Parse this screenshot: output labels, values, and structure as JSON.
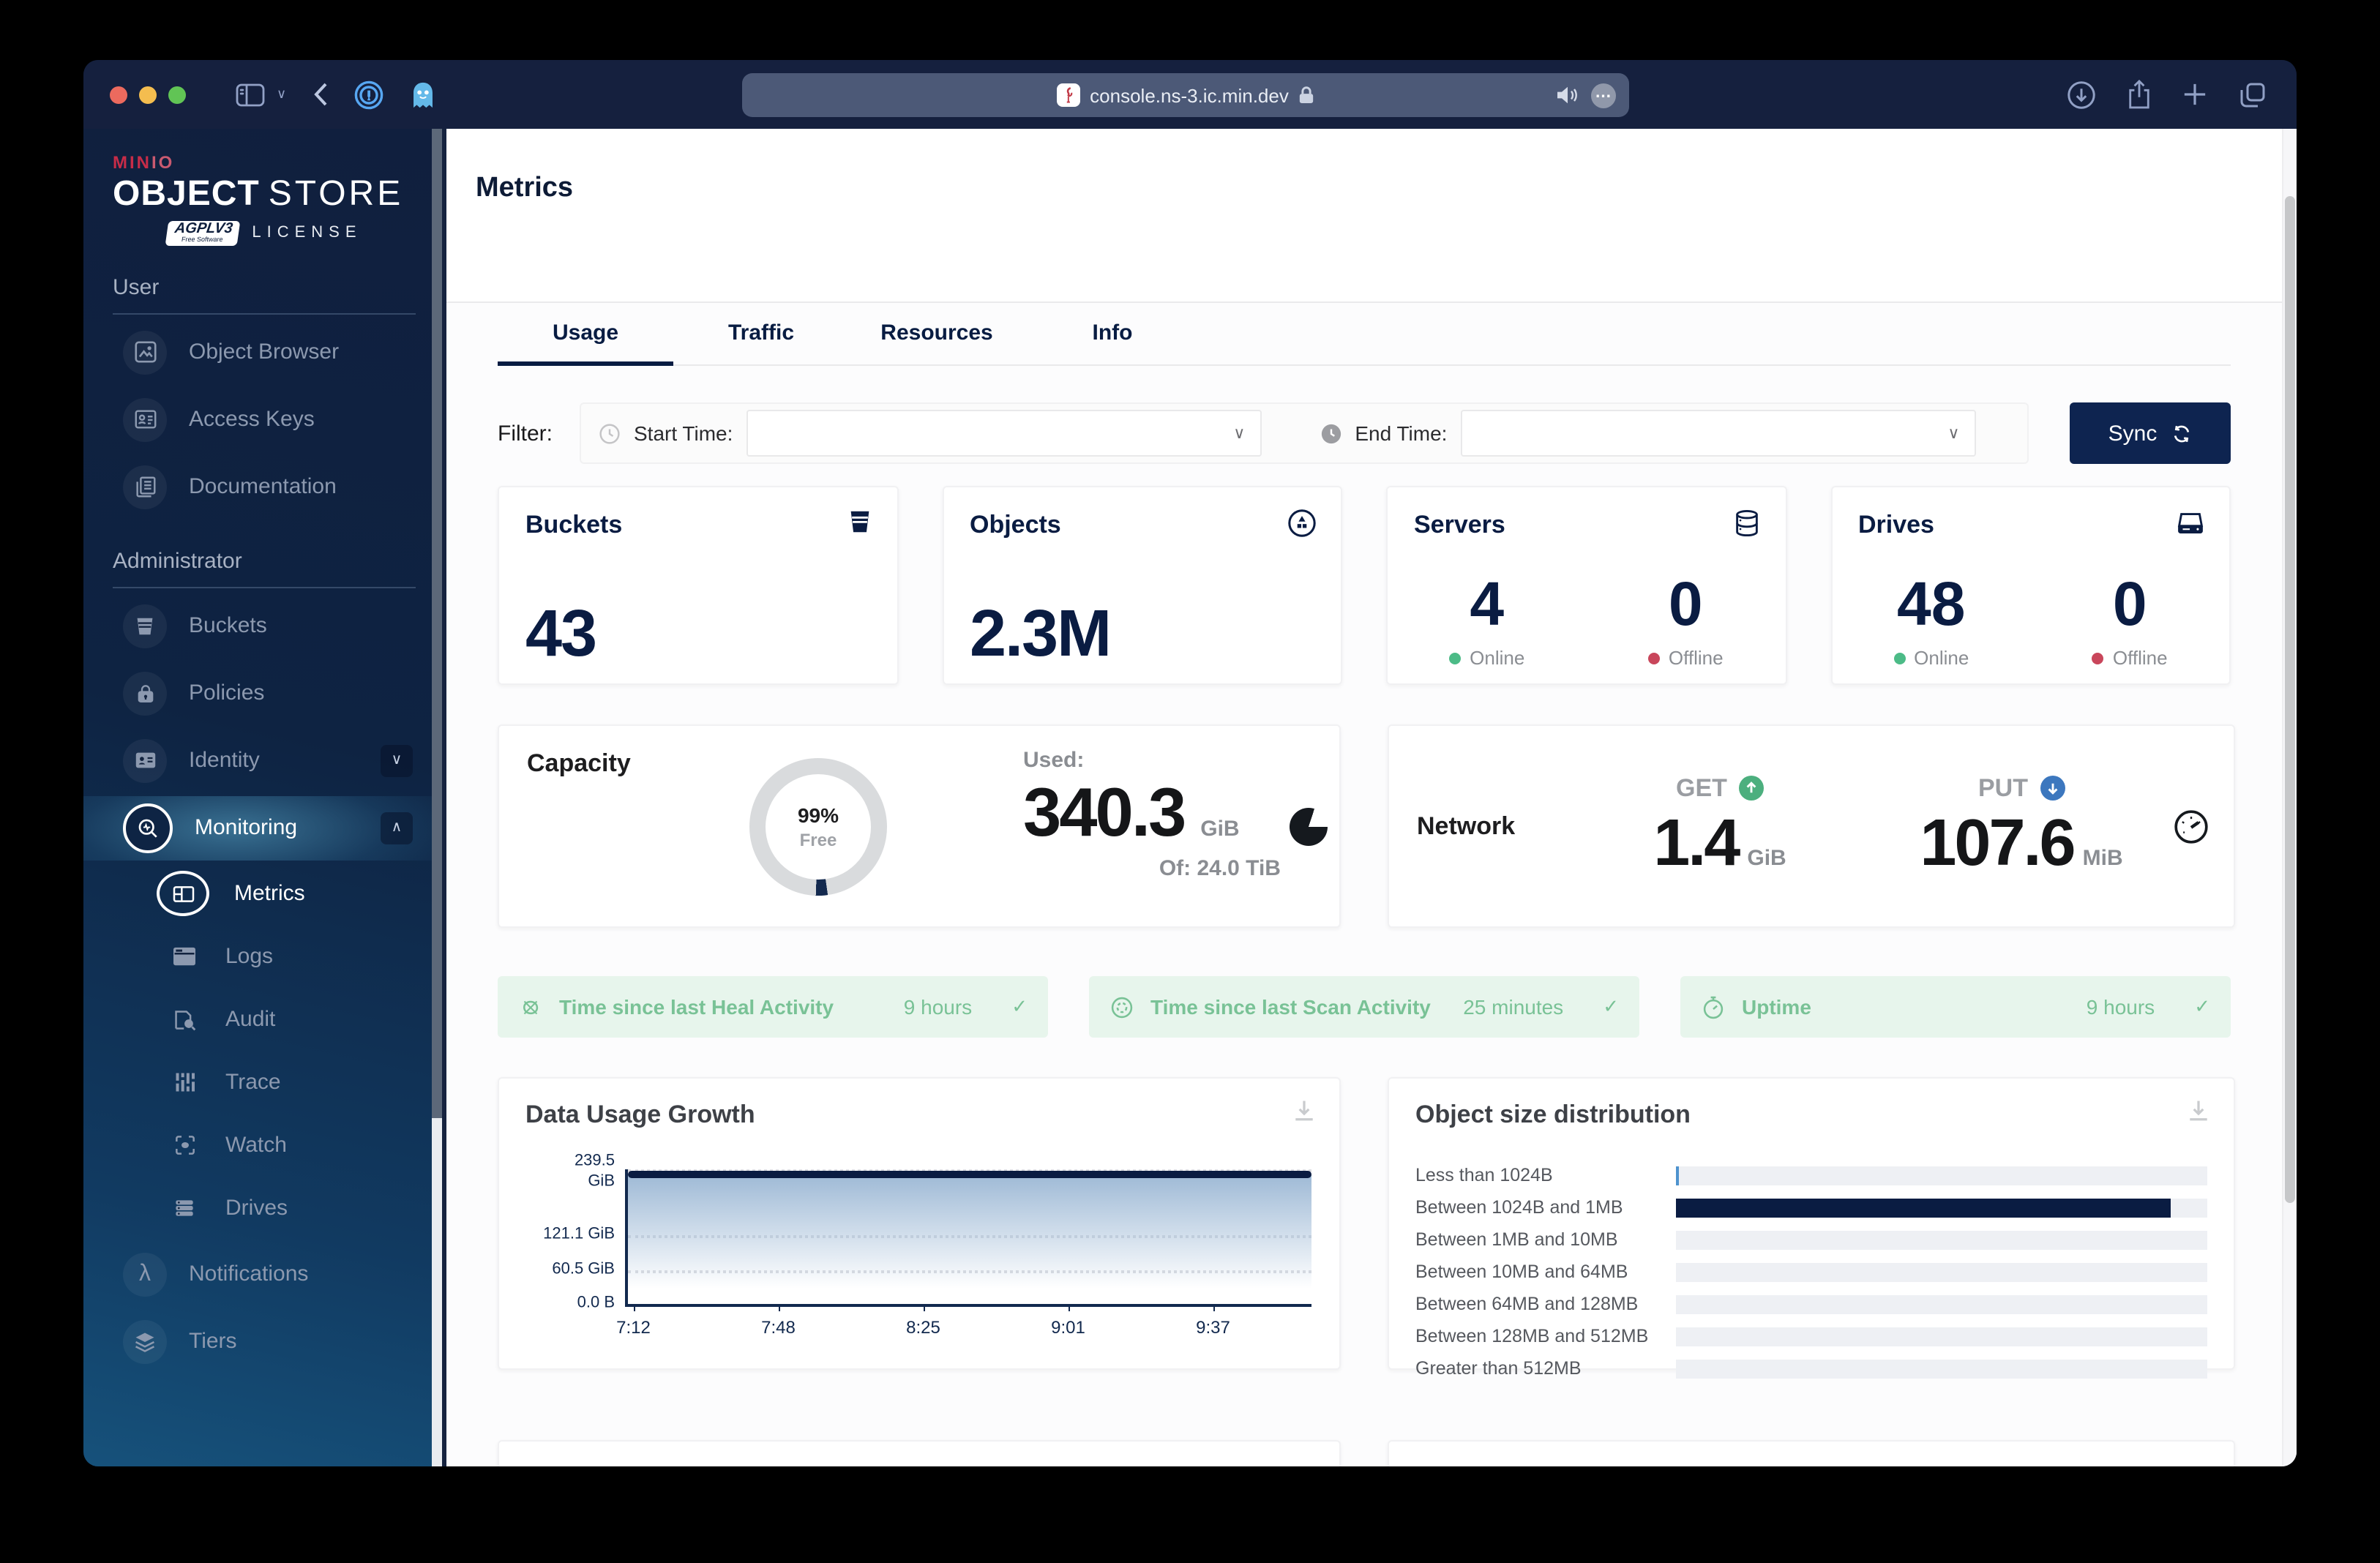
{
  "colors": {
    "brand_navy": "#081C42",
    "brand_red": "#C72C48",
    "online_green": "#4CBB87",
    "offline_red": "#C9465B",
    "get_green": "#4CAF7E",
    "put_blue": "#3C77BE",
    "status_green_text": "#79C296",
    "status_green_bg": "#E7F5EC",
    "bar_light_blue": "#4E93CE"
  },
  "browser": {
    "url": "console.ns-3.ic.min.dev"
  },
  "sidebar": {
    "logo": {
      "brand_bold": "MIN",
      "brand_light": "IO",
      "product_bold": "OBJECT",
      "product_light": "STORE",
      "license_badge": "AGPLV3",
      "license_badge_sub": "Free Software",
      "license_label": "LICENSE"
    },
    "user_section": {
      "label": "User",
      "items": [
        {
          "label": "Object Browser"
        },
        {
          "label": "Access Keys"
        },
        {
          "label": "Documentation"
        }
      ]
    },
    "admin_section": {
      "label": "Administrator",
      "items": [
        {
          "label": "Buckets"
        },
        {
          "label": "Policies"
        },
        {
          "label": "Identity"
        },
        {
          "label": "Monitoring"
        }
      ]
    },
    "monitoring_submenu": [
      {
        "label": "Metrics"
      },
      {
        "label": "Logs"
      },
      {
        "label": "Audit"
      },
      {
        "label": "Trace"
      },
      {
        "label": "Watch"
      },
      {
        "label": "Drives"
      }
    ],
    "more_items": [
      {
        "label": "Notifications"
      },
      {
        "label": "Tiers"
      }
    ]
  },
  "page": {
    "title": "Metrics",
    "tabs": [
      {
        "label": "Usage"
      },
      {
        "label": "Traffic"
      },
      {
        "label": "Resources"
      },
      {
        "label": "Info"
      }
    ],
    "filter": {
      "label": "Filter:",
      "start_time_label": "Start Time:",
      "start_time_value": "",
      "end_time_label": "End Time:",
      "end_time_value": "",
      "sync_button": "Sync"
    }
  },
  "summary_cards": {
    "buckets": {
      "title": "Buckets",
      "value": "43"
    },
    "objects": {
      "title": "Objects",
      "value": "2.3M"
    },
    "servers": {
      "title": "Servers",
      "online": "4",
      "online_label": "Online",
      "offline": "0",
      "offline_label": "Offline"
    },
    "drives": {
      "title": "Drives",
      "online": "48",
      "online_label": "Online",
      "offline": "0",
      "offline_label": "Offline"
    }
  },
  "capacity_card": {
    "title": "Capacity",
    "gauge_pct": "99%",
    "gauge_label": "Free",
    "used_label": "Used:",
    "used_value": "340.3",
    "used_unit": "GiB",
    "total_label": "Of: 24.0 TiB"
  },
  "network_card": {
    "title": "Network",
    "get_label": "GET",
    "get_value": "1.4",
    "get_unit": "GiB",
    "put_label": "PUT",
    "put_value": "107.6",
    "put_unit": "MiB"
  },
  "status_bars": [
    {
      "label": "Time since last Heal Activity",
      "value": "9 hours"
    },
    {
      "label": "Time since last Scan Activity",
      "value": "25 minutes"
    },
    {
      "label": "Uptime",
      "value": "9 hours"
    }
  ],
  "chart_data": [
    {
      "type": "area",
      "title": "Data Usage Growth",
      "x": [
        "7:12",
        "7:48",
        "8:25",
        "9:01",
        "9:37"
      ],
      "series": [
        {
          "name": "Data Usage",
          "values": [
            232,
            232,
            232,
            232,
            232,
            232
          ]
        }
      ],
      "y_ticks": [
        {
          "line1": "239.5",
          "line2": "GiB"
        },
        {
          "line1": "121.1 GiB",
          "line2": ""
        },
        {
          "line1": "60.5 GiB",
          "line2": ""
        },
        {
          "line1": "0.0 B",
          "line2": ""
        }
      ],
      "ylim": [
        0,
        239.5
      ],
      "grid": "dotted horizontal",
      "legend": "none",
      "line_color": "#081C42"
    },
    {
      "type": "bar",
      "title": "Object size distribution",
      "orientation": "horizontal",
      "categories": [
        "Less than 1024B",
        "Between 1024B and 1MB",
        "Between 1MB and 10MB",
        "Between 10MB and 64MB",
        "Between 64MB and 128MB",
        "Between 128MB and 512MB",
        "Greater than 512MB"
      ],
      "values_pct": [
        0.6,
        93,
        0,
        0,
        0,
        0,
        0
      ],
      "bar_colors": [
        "#4E93CE",
        "#081C42",
        "#081C42",
        "#081C42",
        "#081C42",
        "#081C42",
        "#081C42"
      ],
      "xlabel": "",
      "ylabel": ""
    }
  ]
}
